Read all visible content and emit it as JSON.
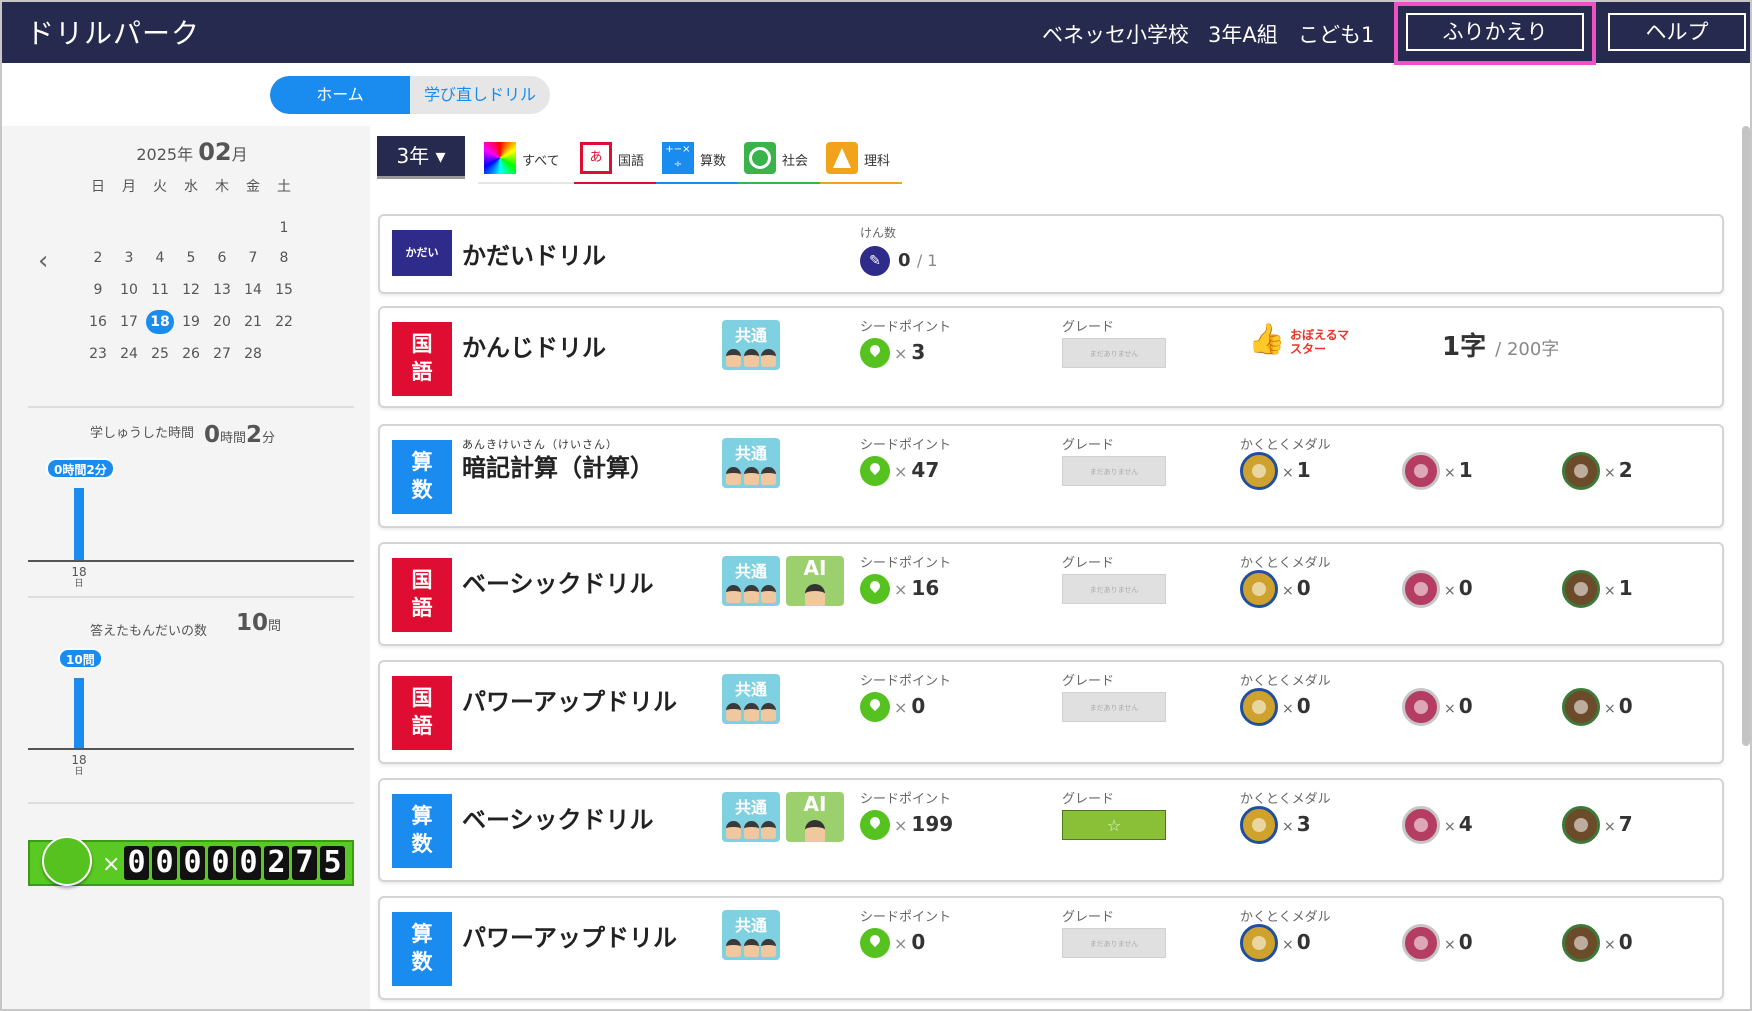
{
  "header": {
    "title": "ドリルパーク",
    "school": "ベネッセ小学校",
    "class": "3年A組",
    "user": "こども1",
    "review_btn": "ふりかえり",
    "help_btn": "ヘルプ"
  },
  "nav": {
    "home": "ホーム",
    "relearn": "学び直しドリル"
  },
  "calendar": {
    "year": "2025年",
    "month": "02",
    "month_unit": "月",
    "prev": "‹",
    "weekdays": [
      "日",
      "月",
      "火",
      "水",
      "木",
      "金",
      "土"
    ],
    "days": [
      "1",
      "2",
      "3",
      "4",
      "5",
      "6",
      "7",
      "8",
      "9",
      "10",
      "11",
      "12",
      "13",
      "14",
      "15",
      "16",
      "17",
      "18",
      "19",
      "20",
      "21",
      "22",
      "23",
      "24",
      "25",
      "26",
      "27",
      "28"
    ],
    "today": "18"
  },
  "stats": {
    "study_label": "学しゅうした時間",
    "study_value": "0",
    "study_h": "時間",
    "study_min": "2",
    "study_m": "分",
    "study_bubble": "0時間2分",
    "study_axis_day": "18",
    "study_axis_unit": "日",
    "answered_label": "答えたもんだいの数",
    "answered_value": "10",
    "answered_unit": "問",
    "answered_bubble": "10問",
    "answered_axis_day": "18",
    "answered_axis_unit": "日"
  },
  "seed_total": {
    "x": "×",
    "digits": [
      "0",
      "0",
      "0",
      "0",
      "0",
      "2",
      "7",
      "5"
    ]
  },
  "filter": {
    "grade": "3年 ▾",
    "tabs": [
      {
        "label": "すべて",
        "color": "#e6e6e6"
      },
      {
        "label": "国語",
        "color": "#df0d31"
      },
      {
        "label": "算数",
        "color": "#1a8cf0"
      },
      {
        "label": "社会",
        "color": "#3ab34a"
      },
      {
        "label": "理科",
        "color": "#f3a21c"
      }
    ],
    "kanji_glyph": "あ",
    "math_glyph": "+−×÷"
  },
  "labels": {
    "kenzu": "けん数",
    "seed": "シードポイント",
    "grade": "グレード",
    "medal": "かくとくメダル",
    "times": "×",
    "grade_empty": "まだありません",
    "kyotsu": "共通",
    "ai": "AI"
  },
  "cards": [
    {
      "subject": "かだい",
      "name": "かだいドリル",
      "count": "0",
      "total": "/ 1"
    },
    {
      "subject": "国語",
      "name": "かんじドリル",
      "seed": "3",
      "master": "おぼえるマスター",
      "ji": "1字",
      "ji_total": "/ 200字"
    },
    {
      "subject": "算数",
      "ruby": "あんきけいさん（けいさん）",
      "name": "暗記計算（計算）",
      "seed": "47",
      "medals": [
        "1",
        "1",
        "2"
      ]
    },
    {
      "subject": "国語",
      "name": "ベーシックドリル",
      "seed": "16",
      "medals": [
        "0",
        "0",
        "1"
      ]
    },
    {
      "subject": "国語",
      "name": "パワーアップドリル",
      "seed": "0",
      "medals": [
        "0",
        "0",
        "0"
      ]
    },
    {
      "subject": "算数",
      "name": "ベーシックドリル",
      "seed": "199",
      "medals": [
        "3",
        "4",
        "7"
      ],
      "grade_star": "☆"
    },
    {
      "subject": "算数",
      "name": "パワーアップドリル",
      "seed": "0",
      "medals": [
        "0",
        "0",
        "0"
      ]
    }
  ]
}
